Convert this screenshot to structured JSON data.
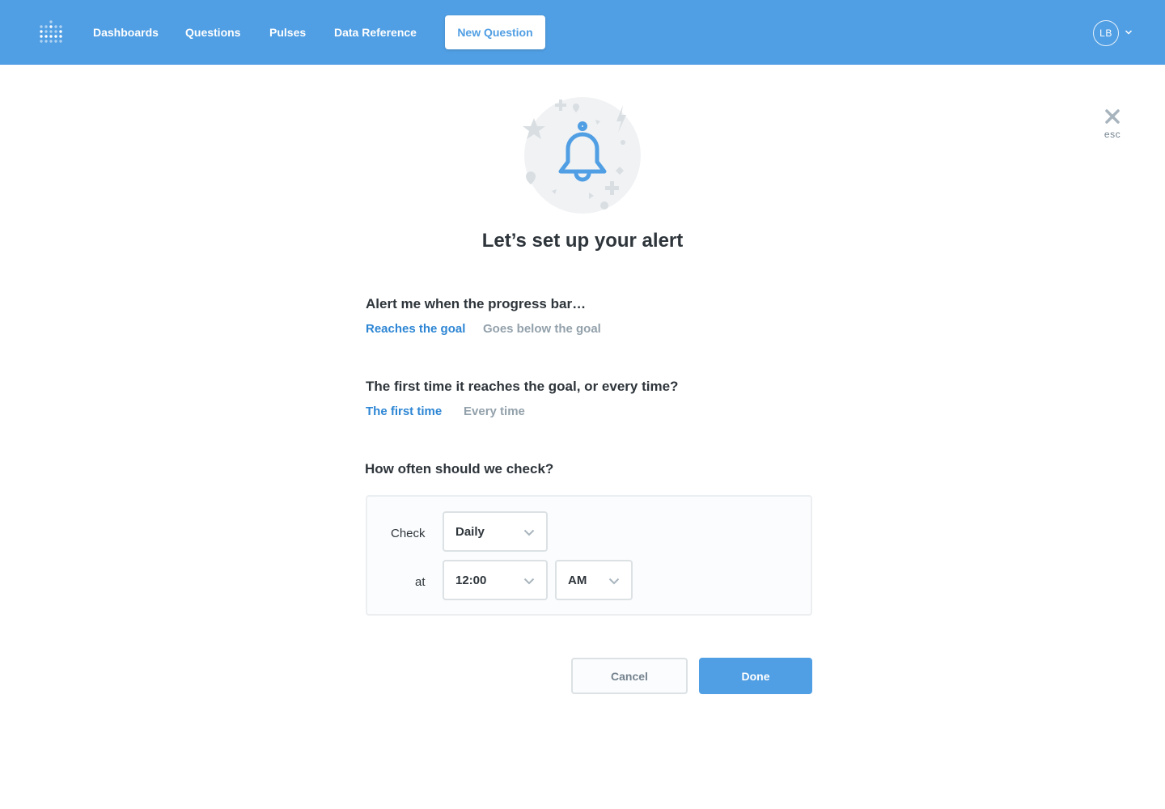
{
  "nav": {
    "logo_icon": "metabase-logo-icon",
    "items": [
      "Dashboards",
      "Questions",
      "Pulses",
      "Data Reference"
    ],
    "new_question": "New Question",
    "avatar_initials": "LB",
    "brand_color": "#509ee3"
  },
  "close": {
    "icon": "close-icon",
    "label": "esc"
  },
  "illustration_icon": "bell-icon",
  "title": "Let’s set up your alert",
  "goal_condition": {
    "question": "Alert me when the progress bar…",
    "options": [
      "Reaches the goal",
      "Goes below the goal"
    ],
    "selected": "Reaches the goal"
  },
  "frequency_condition": {
    "question": "The first time it reaches the goal, or every time?",
    "options": [
      "The first time",
      "Every time"
    ],
    "selected": "The first time"
  },
  "schedule": {
    "question": "How often should we check?",
    "check_label": "Check",
    "check_value": "Daily",
    "at_label": "at",
    "time_value": "12:00",
    "ampm_value": "AM"
  },
  "actions": {
    "cancel": "Cancel",
    "done": "Done"
  },
  "colors": {
    "accent": "#509ee3",
    "active_option": "#2d86d4",
    "inactive_option": "#93a1ab"
  }
}
